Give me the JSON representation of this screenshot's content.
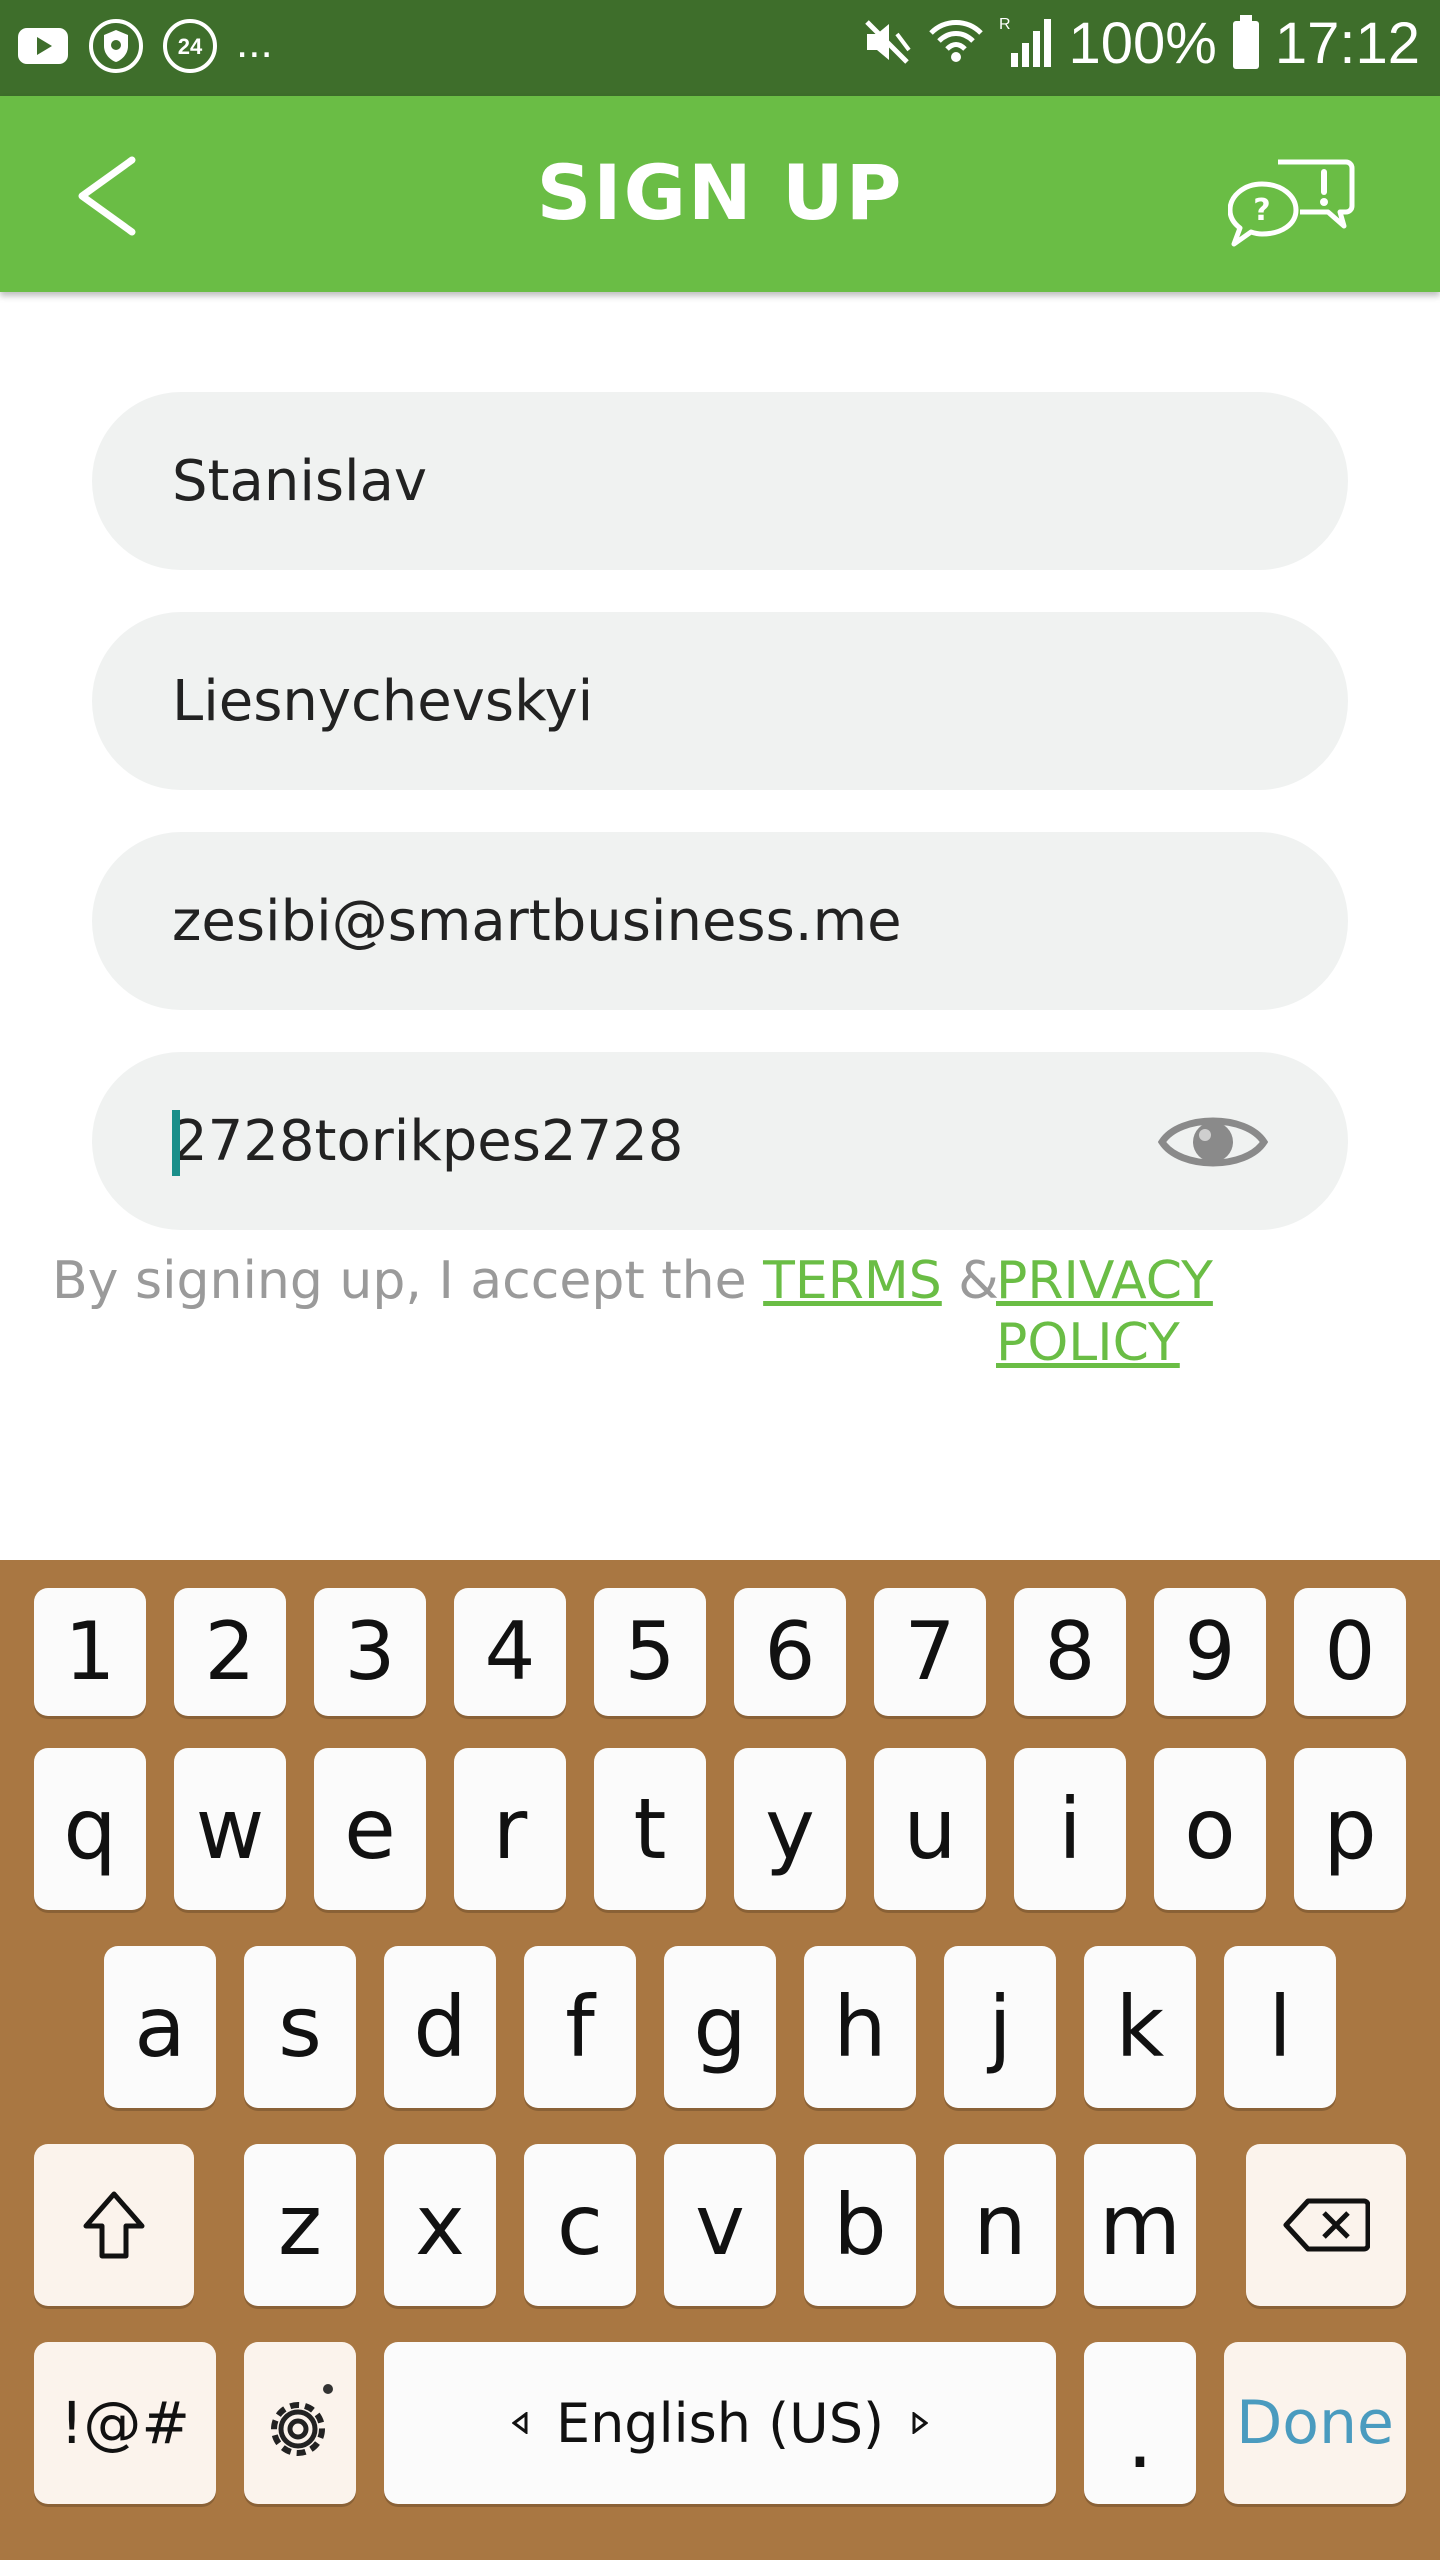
{
  "status_bar": {
    "notification_24": "24",
    "overflow": "...",
    "battery": "100%",
    "time": "17:12",
    "icons": [
      "youtube-icon",
      "shield-icon",
      "badge-24-icon",
      "mute-icon",
      "wifi-icon",
      "signal-icon",
      "battery-icon"
    ]
  },
  "app_bar": {
    "title": "SIGN UP",
    "back_icon": "chevron-left-icon",
    "help_icon": "chat-help-icon"
  },
  "form": {
    "first_name": "Stanislav",
    "last_name": "Liesnychevskyi",
    "email": "zesibi@smartbusiness.me",
    "password": "2728torikpes2728",
    "eye_icon": "eye-icon"
  },
  "terms": {
    "prefix": "By signing up, I accept the ",
    "terms_link": "TERMS",
    "amp": " & ",
    "privacy_link_line1": "PRIVACY",
    "privacy_link_line2": "POLICY"
  },
  "keyboard": {
    "number_row": [
      "1",
      "2",
      "3",
      "4",
      "5",
      "6",
      "7",
      "8",
      "9",
      "0"
    ],
    "row1": [
      "q",
      "w",
      "e",
      "r",
      "t",
      "y",
      "u",
      "i",
      "o",
      "p"
    ],
    "row2": [
      "a",
      "s",
      "d",
      "f",
      "g",
      "h",
      "j",
      "k",
      "l"
    ],
    "row3": [
      "z",
      "x",
      "c",
      "v",
      "b",
      "n",
      "m"
    ],
    "symbols": "!@#",
    "space": "English (US)",
    "period": ".",
    "done": "Done",
    "colors": {
      "background": "#a97742",
      "done": "#4a9bbf"
    }
  },
  "colors": {
    "status_bar": "#3e6e2b",
    "app_bar": "#6abd45",
    "field_bg": "#f0f2f1",
    "link": "#6abd45"
  }
}
